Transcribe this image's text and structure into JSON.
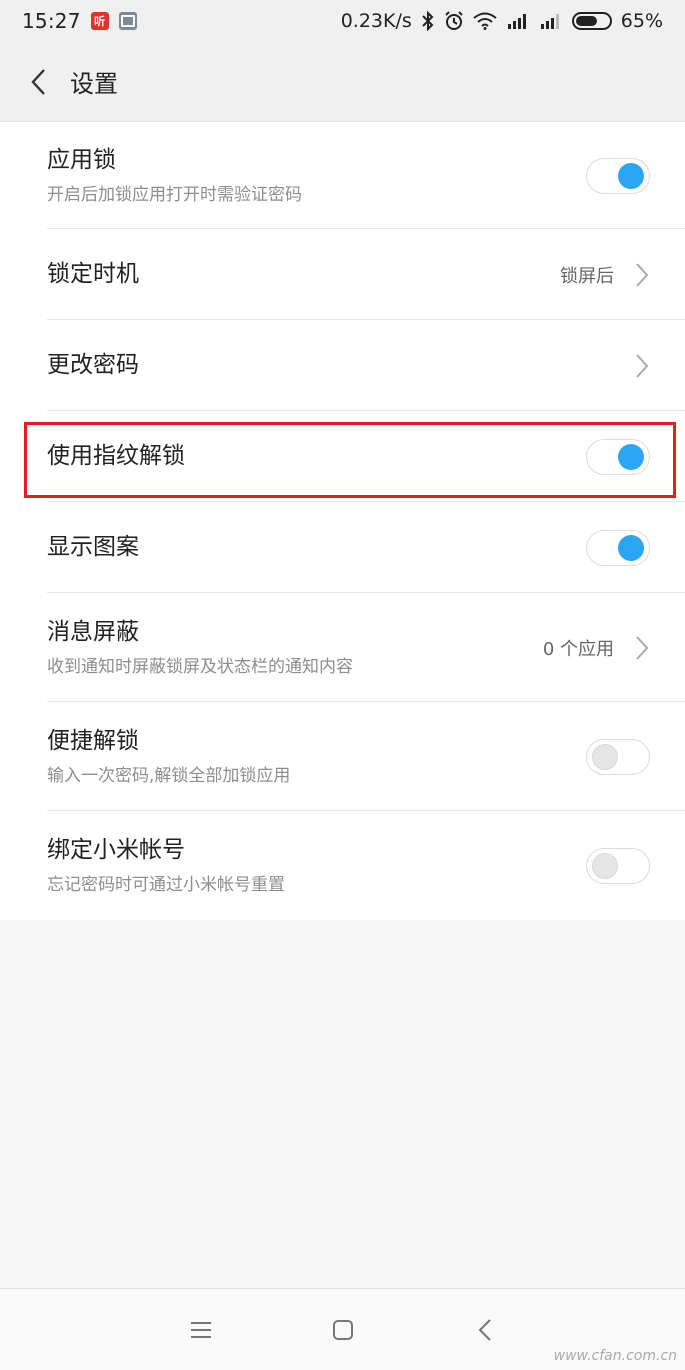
{
  "status_bar": {
    "time": "15:27",
    "app_badge_text": "听",
    "net_speed": "0.23K/s",
    "battery_level": 0.65,
    "battery_pct": "65%",
    "icons": [
      "bluetooth-icon",
      "alarm-icon",
      "wifi-icon",
      "signal-icon",
      "signal-icon",
      "battery-icon"
    ]
  },
  "titlebar": {
    "title": "设置"
  },
  "settings": [
    {
      "title": "应用锁",
      "subtitle": "开启后加锁应用打开时需验证密码",
      "control": "toggle",
      "on": true
    },
    {
      "title": "锁定时机",
      "value": "锁屏后",
      "control": "chevron"
    },
    {
      "title": "更改密码",
      "control": "chevron"
    },
    {
      "title": "使用指纹解锁",
      "control": "toggle",
      "on": true,
      "highlighted": true
    },
    {
      "title": "显示图案",
      "control": "toggle",
      "on": true
    },
    {
      "title": "消息屏蔽",
      "subtitle": "收到通知时屏蔽锁屏及状态栏的通知内容",
      "value": "0 个应用",
      "control": "chevron"
    },
    {
      "title": "便捷解锁",
      "subtitle": "输入一次密码,解锁全部加锁应用",
      "control": "toggle",
      "on": false
    },
    {
      "title": "绑定小米帐号",
      "subtitle": "忘记密码时可通过小米帐号重置",
      "control": "toggle",
      "on": false
    }
  ],
  "colors": {
    "accent": "#2aa6f5",
    "highlight_border": "#e02020"
  },
  "watermark": "www.cfan.com.cn"
}
